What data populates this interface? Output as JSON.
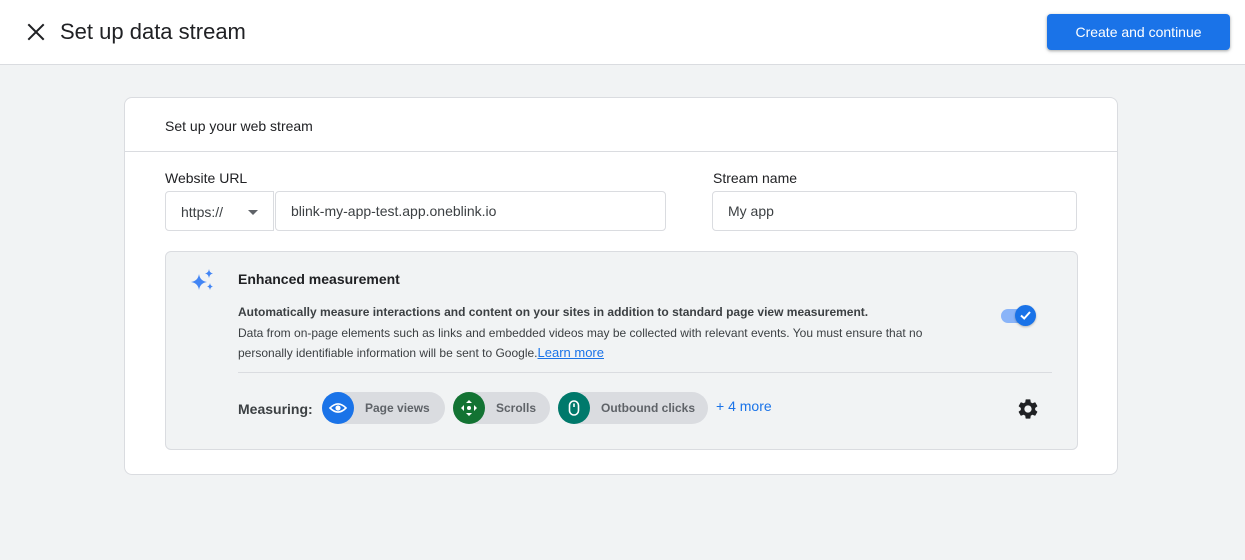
{
  "header": {
    "title": "Set up data stream",
    "primary_button": "Create and continue",
    "close_icon": "close-icon"
  },
  "card": {
    "header": "Set up your web stream",
    "website_url": {
      "label": "Website URL",
      "protocol": "https://",
      "value": "blink-my-app-test.app.oneblink.io"
    },
    "stream_name": {
      "label": "Stream name",
      "value": "My app"
    }
  },
  "enhanced_measurement": {
    "icon": "sparkle-icon",
    "title": "Enhanced measurement",
    "description_bold": "Automatically measure interactions and content on your sites in addition to standard page view measurement.",
    "description": "Data from on-page elements such as links and embedded videos may be collected with relevant events. You must ensure that no personally identifiable information will be sent to Google.",
    "learn_more": "Learn more",
    "enabled": true,
    "measuring_label": "Measuring:",
    "chips": [
      {
        "label": "Page views",
        "icon": "eye-icon",
        "color": "#1a73e8"
      },
      {
        "label": "Scrolls",
        "icon": "scroll-icon",
        "color": "#137333"
      },
      {
        "label": "Outbound clicks",
        "icon": "mouse-icon",
        "color": "#00796b"
      }
    ],
    "more_link": "+ 4 more",
    "settings_icon": "gear-icon"
  },
  "colors": {
    "accent": "#1a73e8",
    "background": "#f1f3f4"
  }
}
